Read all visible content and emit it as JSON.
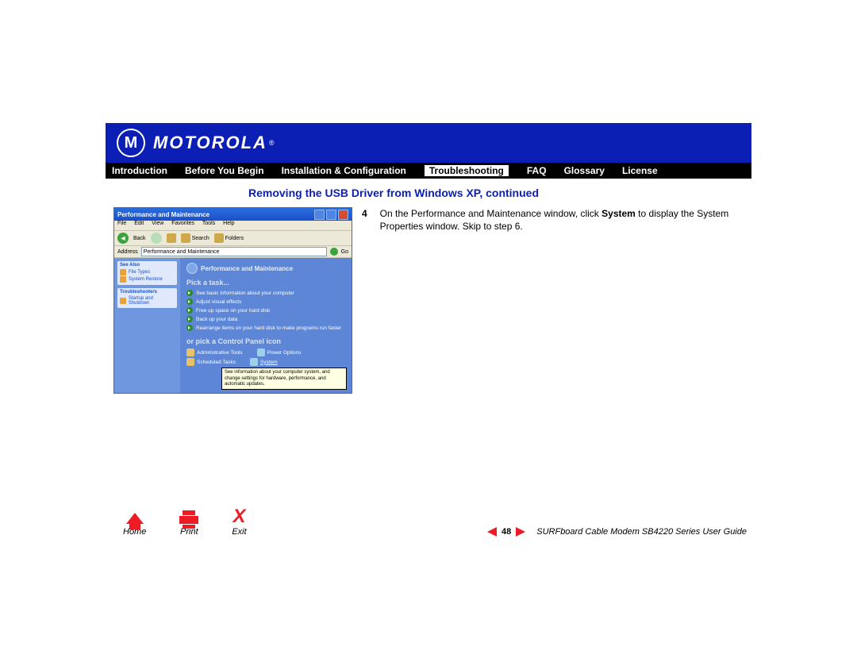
{
  "brand": {
    "name": "MOTOROLA",
    "reg": "®"
  },
  "nav": {
    "items": [
      "Introduction",
      "Before You Begin",
      "Installation & Configuration",
      "Troubleshooting",
      "FAQ",
      "Glossary",
      "License"
    ],
    "active_index": 3
  },
  "section_title": "Removing the USB Driver from Windows XP, continued",
  "step": {
    "num": "4",
    "pre": "On the Performance and Maintenance window, click ",
    "bold": "System",
    "post": " to display the System Properties window. Skip to step 6."
  },
  "screenshot": {
    "title": "Performance and Maintenance",
    "menu": [
      "File",
      "Edit",
      "View",
      "Favorites",
      "Tools",
      "Help"
    ],
    "toolbar": {
      "back_label": "Back",
      "search_label": "Search",
      "folders_label": "Folders"
    },
    "address_label": "Address",
    "address_value": "Performance and Maintenance",
    "go_label": "Go",
    "side": {
      "box1_title": "See Also",
      "box1_items": [
        "File Types",
        "System Restore"
      ],
      "box2_title": "Troubleshooters",
      "box2_items": [
        "Startup and Shutdown"
      ]
    },
    "main": {
      "header": "Performance and Maintenance",
      "pick_label": "Pick a task...",
      "tasks": [
        "See basic information about your computer",
        "Adjust visual effects",
        "Free up space on your hard disk",
        "Back up your data",
        "Rearrange items on your hard disk to make programs run faster"
      ],
      "cp_label": "or pick a Control Panel icon",
      "cp_icons": [
        "Administrative Tools",
        "Power Options",
        "Scheduled Tasks",
        "System"
      ],
      "tooltip": "See information about your computer system, and change settings for hardware, performance, and automatic updates."
    }
  },
  "footer": {
    "home": "Home",
    "print": "Print",
    "exit": "Exit",
    "page": "48",
    "guide": "SURFboard Cable Modem SB4220 Series User Guide"
  }
}
